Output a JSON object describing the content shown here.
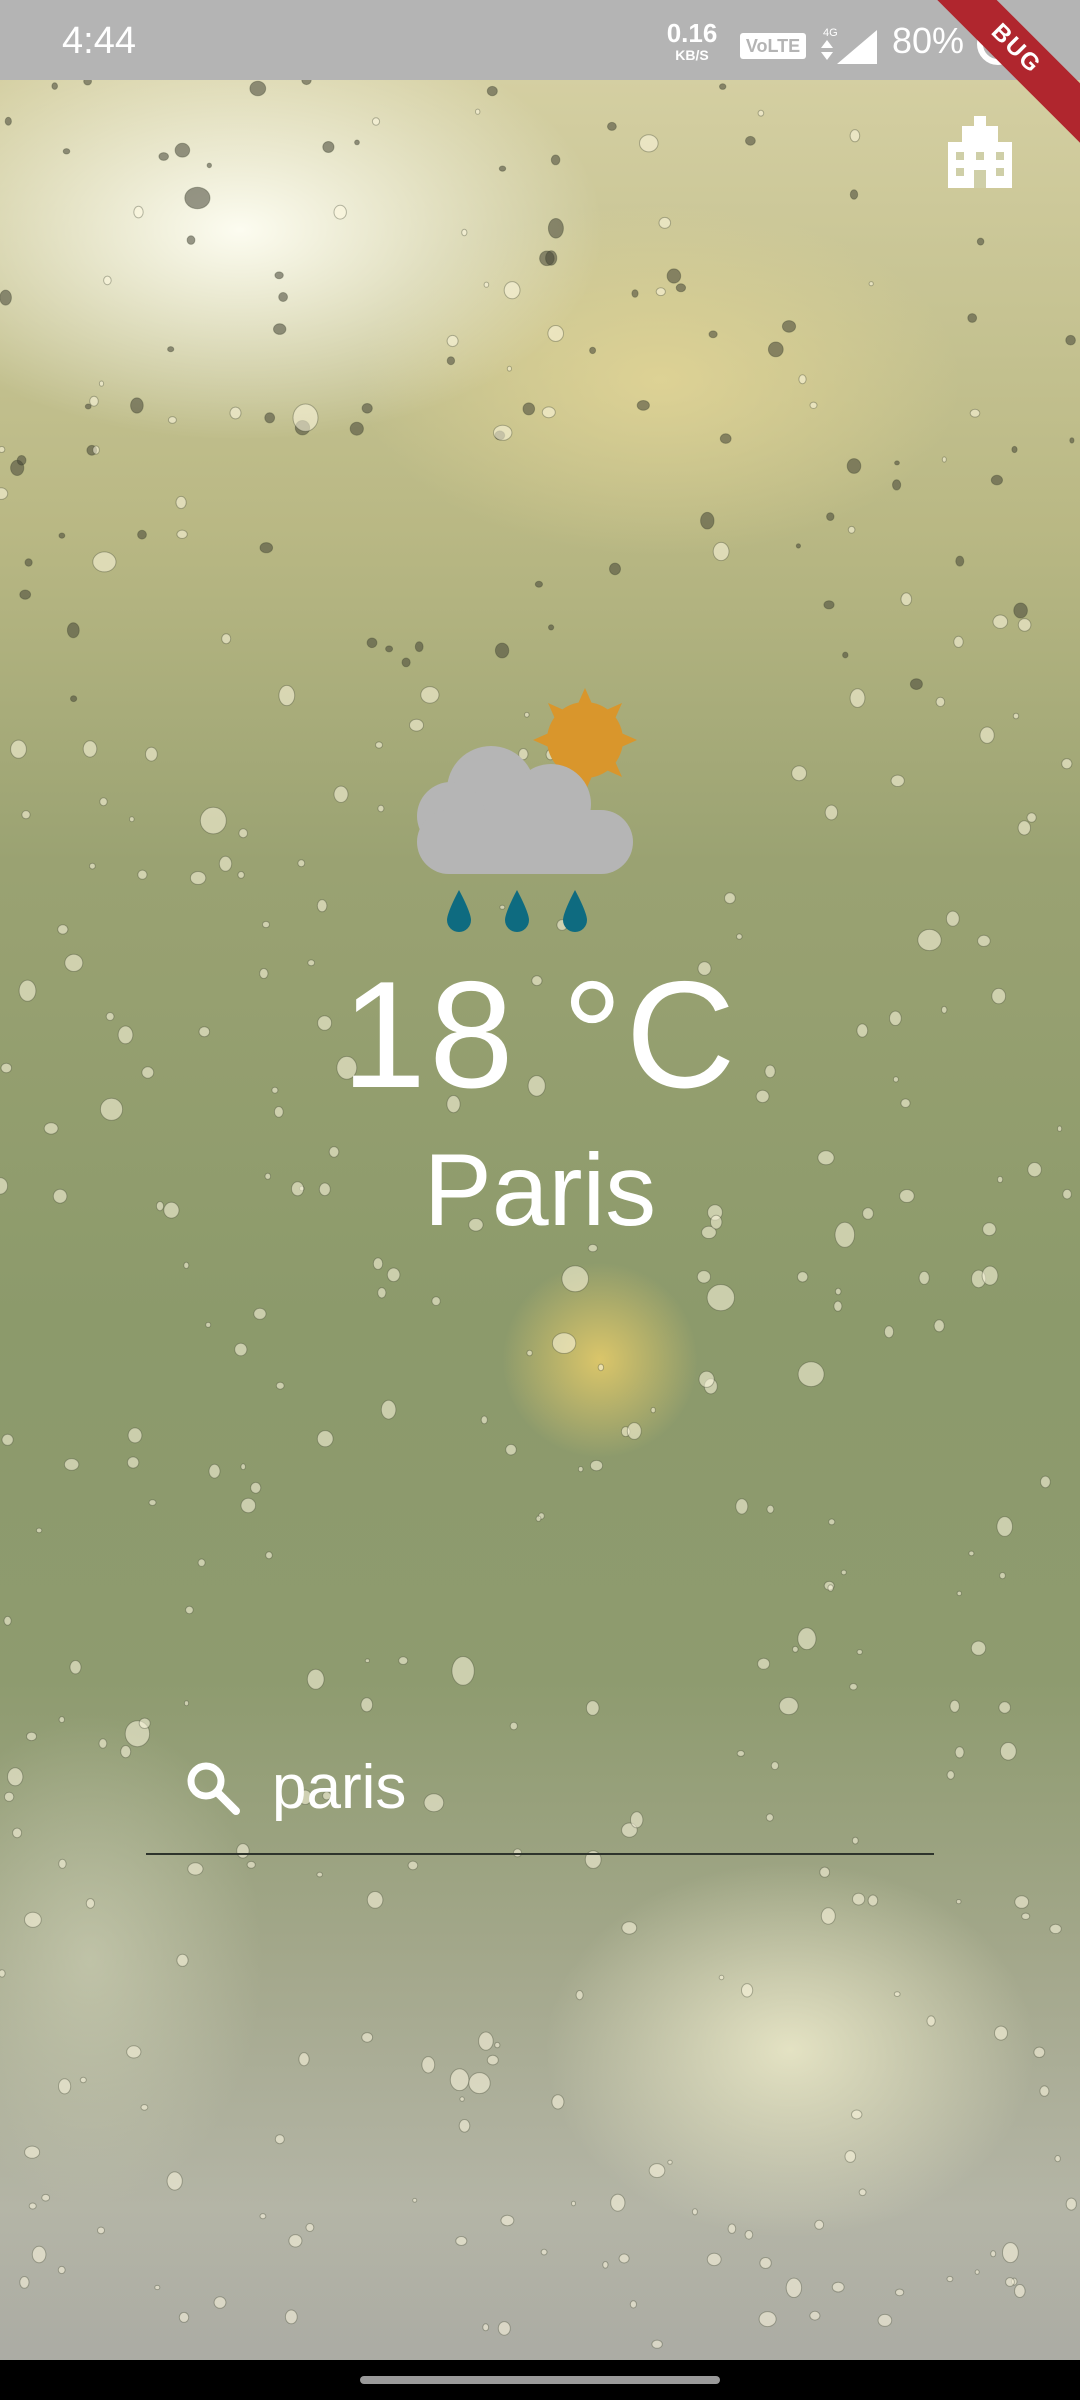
{
  "status_bar": {
    "time": "4:44",
    "net_speed_value": "0.16",
    "net_speed_unit": "KB/S",
    "volte_label": "VoLTE",
    "network_type": "4G",
    "battery_percent": "80%",
    "debug_banner": "BUG"
  },
  "weather": {
    "condition_icon": "rain-sun-cloud-icon",
    "temperature": "18 °C",
    "city": "Paris"
  },
  "search": {
    "value": "paris",
    "icon": "search-icon"
  },
  "colors": {
    "sun": "#d9962c",
    "cloud": "#b5b5b5",
    "rain_drop": "#0e6b80",
    "text": "#ffffff",
    "status_bar": "#b4b4b4",
    "debug_ribbon": "#b0262e"
  }
}
